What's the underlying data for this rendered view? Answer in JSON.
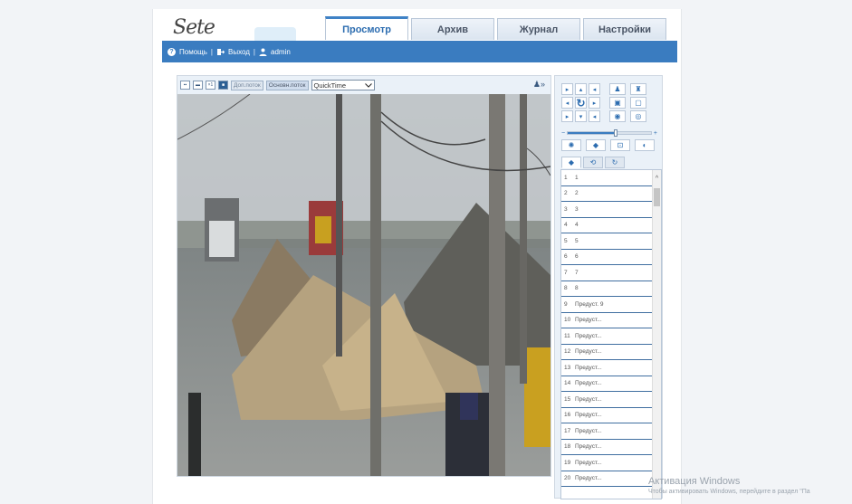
{
  "header": {
    "logo_text": "Sete",
    "tabs": [
      {
        "label": "Просмотр",
        "active": true
      },
      {
        "label": "Архив",
        "active": false
      },
      {
        "label": "Журнал",
        "active": false
      },
      {
        "label": "Настройки",
        "active": false
      }
    ]
  },
  "userbar": {
    "help_label": "Помощь",
    "logout_label": "Выход",
    "user_label": "admin",
    "separator": "|"
  },
  "video_toolbar": {
    "aspect_buttons": [
      "4:3",
      "16:9",
      "1:1",
      "fit"
    ],
    "sub_stream_label": "Доп.поток",
    "main_stream_label": "Основн.поток",
    "player_value": "QuickTime",
    "fullscreen_icon": "play-expand-icon"
  },
  "ptz": {
    "speed_level": 0.58,
    "presets": [
      {
        "num": "1",
        "name": "1"
      },
      {
        "num": "2",
        "name": "2"
      },
      {
        "num": "3",
        "name": "3"
      },
      {
        "num": "4",
        "name": "4"
      },
      {
        "num": "5",
        "name": "5"
      },
      {
        "num": "6",
        "name": "6"
      },
      {
        "num": "7",
        "name": "7"
      },
      {
        "num": "8",
        "name": "8"
      },
      {
        "num": "9",
        "name": "Предуст. 9"
      },
      {
        "num": "10",
        "name": "Предуст..."
      },
      {
        "num": "11",
        "name": "Предуст..."
      },
      {
        "num": "12",
        "name": "Предуст..."
      },
      {
        "num": "13",
        "name": "Предуст..."
      },
      {
        "num": "14",
        "name": "Предуст..."
      },
      {
        "num": "15",
        "name": "Предуст..."
      },
      {
        "num": "16",
        "name": "Предуст..."
      },
      {
        "num": "17",
        "name": "Предуст..."
      },
      {
        "num": "18",
        "name": "Предуст..."
      },
      {
        "num": "19",
        "name": "Предуст..."
      },
      {
        "num": "20",
        "name": "Предуст..."
      }
    ]
  },
  "watermark": {
    "title": "Активация Windows",
    "subtitle": "Чтобы активировать Windows, перейдите в раздел \"Па"
  },
  "colors": {
    "accent": "#3a7cc0",
    "page_bg": "#f2f4f7"
  }
}
